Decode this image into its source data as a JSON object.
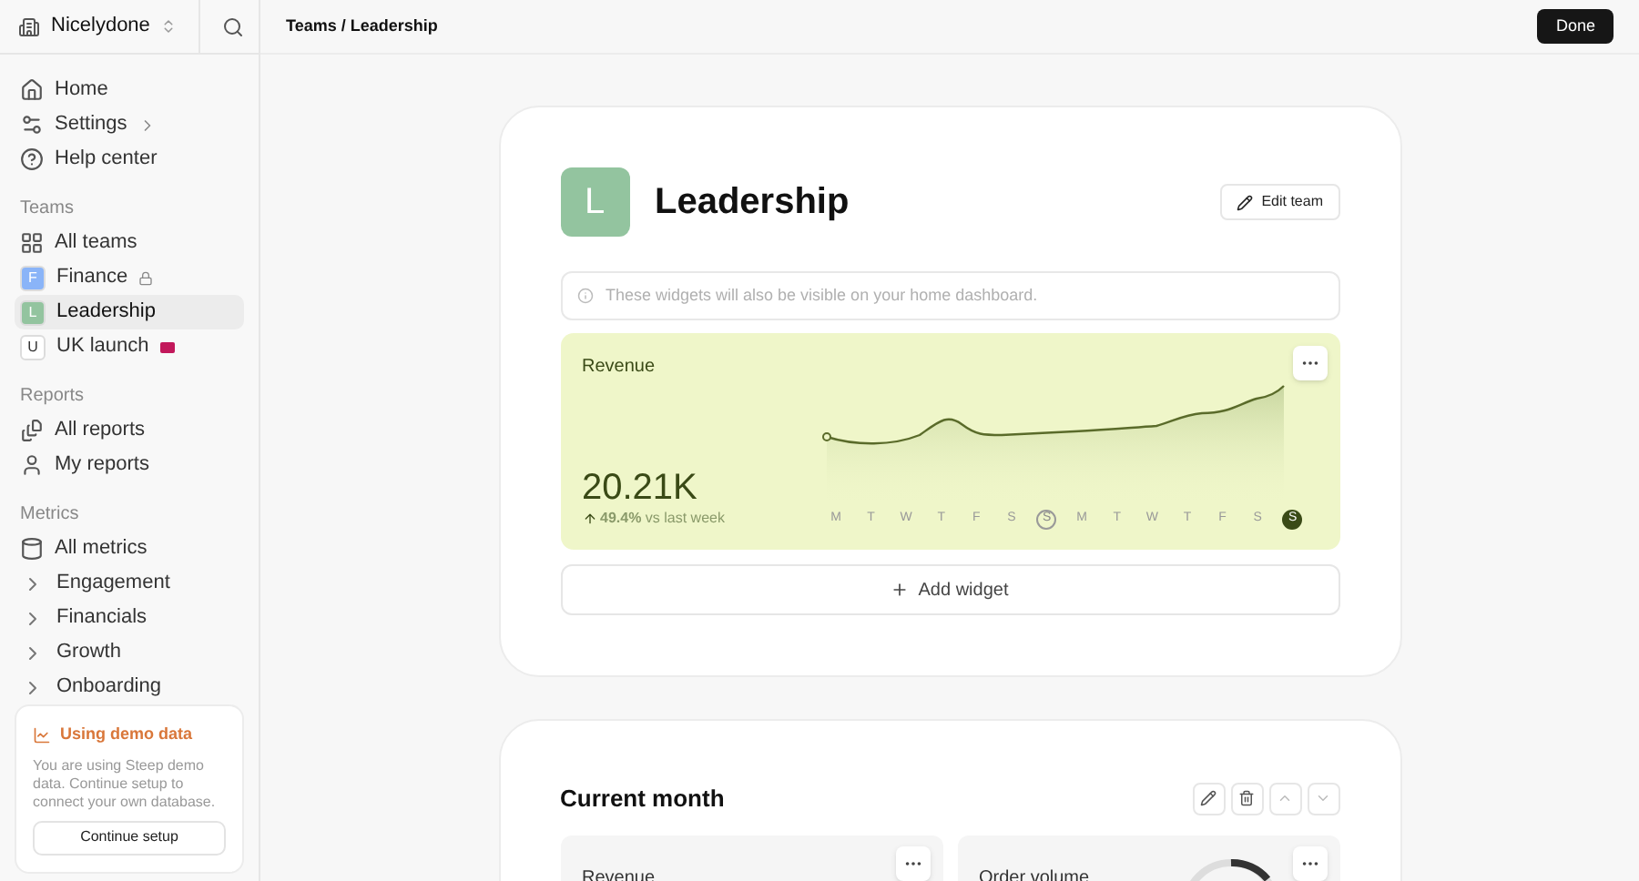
{
  "workspace": {
    "name": "Nicelydone"
  },
  "sidebar": {
    "items": [
      {
        "label": "Home",
        "kind": "icon"
      },
      {
        "label": "Settings",
        "kind": "icon",
        "chevron": true
      },
      {
        "label": "Help center",
        "kind": "icon"
      }
    ],
    "sections": [
      {
        "title": "Teams",
        "items": [
          {
            "label": "All teams",
            "kind": "icon",
            "selected": false
          },
          {
            "label": "Finance",
            "kind": "team",
            "letter": "F",
            "color": "#8ab4f8",
            "locked": true,
            "selected": false
          },
          {
            "label": "Leadership",
            "kind": "team",
            "letter": "L",
            "color": "#93c49f",
            "selected": true
          },
          {
            "label": "UK launch",
            "kind": "team",
            "letter": "U",
            "color": "#ffffff",
            "flag": true,
            "selected": false
          }
        ]
      },
      {
        "title": "Reports",
        "items": [
          {
            "label": "All reports",
            "kind": "icon",
            "selected": false
          },
          {
            "label": "My reports",
            "kind": "icon",
            "selected": false
          }
        ]
      },
      {
        "title": "Metrics",
        "items": [
          {
            "label": "All metrics",
            "kind": "icon",
            "selected": false
          },
          {
            "label": "Engagement",
            "kind": "folder",
            "selected": false
          },
          {
            "label": "Financials",
            "kind": "folder",
            "selected": false
          },
          {
            "label": "Growth",
            "kind": "folder",
            "selected": false
          },
          {
            "label": "Onboarding",
            "kind": "folder",
            "selected": false
          }
        ]
      }
    ],
    "demo": {
      "title": "Using demo data",
      "text": "You are using Steep demo data. Continue setup to connect your own database.",
      "button": "Continue setup"
    }
  },
  "header": {
    "breadcrumb": "Teams / Leadership",
    "button": "Done"
  },
  "team": {
    "letter": "L",
    "name": "Leadership",
    "edit": "Edit team",
    "notice": "These widgets will also be visible on your home dashboard.",
    "widget": {
      "title": "Revenue",
      "value": "20.21K",
      "change": "**49.4%** vs last week",
      "days": [
        {
          "label": "M",
          "kind": "plain"
        },
        {
          "label": "T",
          "kind": "plain"
        },
        {
          "label": "W",
          "kind": "plain"
        },
        {
          "label": "T",
          "kind": "plain"
        },
        {
          "label": "F",
          "kind": "plain"
        },
        {
          "label": "S",
          "kind": "plain"
        },
        {
          "label": "S",
          "kind": "outlined"
        },
        {
          "label": "M",
          "kind": "plain"
        },
        {
          "label": "T",
          "kind": "plain"
        },
        {
          "label": "W",
          "kind": "plain"
        },
        {
          "label": "T",
          "kind": "plain"
        },
        {
          "label": "F",
          "kind": "plain"
        },
        {
          "label": "S",
          "kind": "plain"
        },
        {
          "label": "S",
          "kind": "filled"
        }
      ]
    },
    "add": "Add widget"
  },
  "section": {
    "title": "Current month",
    "widgets": [
      {
        "title": "Revenue",
        "kind": "number"
      },
      {
        "title": "Order volume",
        "kind": "gauge"
      }
    ]
  }
}
